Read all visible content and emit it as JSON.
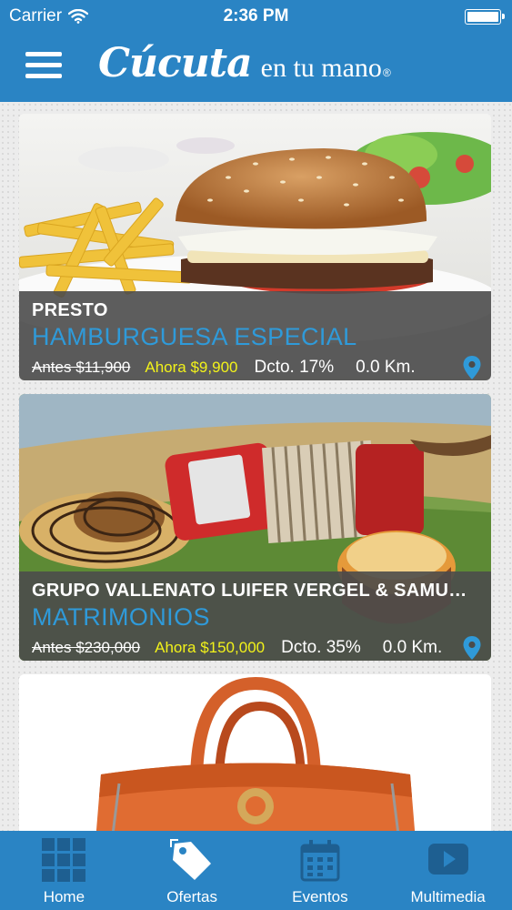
{
  "status_bar": {
    "carrier": "Carrier",
    "time": "2:36 PM"
  },
  "header": {
    "logo_script": "Cúcuta",
    "logo_rest": "en tu mano",
    "logo_reg": "®",
    "background_color": "#2a84c4"
  },
  "cards": [
    {
      "image": "burger-with-fries-photo",
      "business": "PRESTO",
      "product": "HAMBURGUESA ESPECIAL",
      "price_before": "Antes $11,900",
      "price_now": "Ahora $9,900",
      "discount": "Dcto. 17%",
      "distance": "0.0 Km."
    },
    {
      "image": "vallenato-accordion-painting",
      "business": "GRUPO VALLENATO  LUIFER VERGEL & SAMU…",
      "product": "MATRIMONIOS",
      "price_before": "Antes $230,000",
      "price_now": "Ahora $150,000",
      "discount": "Dcto. 35%",
      "distance": "0.0 Km."
    },
    {
      "image": "orange-leather-handbag-photo"
    }
  ],
  "colors": {
    "accent_blue": "#2f9ad9",
    "price_now_yellow": "#f2f21a",
    "overlay": "#4b4b4b"
  },
  "tabbar": {
    "tabs": [
      {
        "label": "Home",
        "icon": "grid-icon"
      },
      {
        "label": "Ofertas",
        "icon": "price-tag-icon",
        "active": true
      },
      {
        "label": "Eventos",
        "icon": "calendar-icon"
      },
      {
        "label": "Multimedia",
        "icon": "play-icon"
      }
    ]
  }
}
